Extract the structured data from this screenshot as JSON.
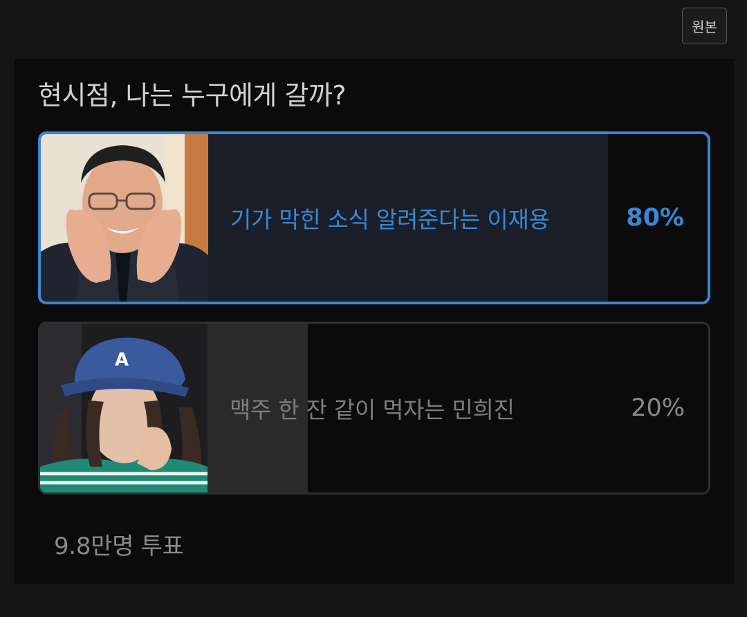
{
  "header": {
    "original_button_label": "원본"
  },
  "poll": {
    "question": "현시점, 나는 누구에게 갈까?",
    "options": [
      {
        "label": "기가 막힌 소식 알려준다는 이재용",
        "percent_text": "80%",
        "share": 0.8,
        "selected": true
      },
      {
        "label": "맥주 한 잔 같이 먹자는 민희진",
        "percent_text": "20%",
        "share": 0.2,
        "selected": false
      }
    ],
    "vote_count": "9.8만명 투표"
  },
  "colors": {
    "accent": "#3a87d3",
    "background": "#151515",
    "card": "#0b0b0b",
    "muted_text": "#8a8a8a"
  }
}
